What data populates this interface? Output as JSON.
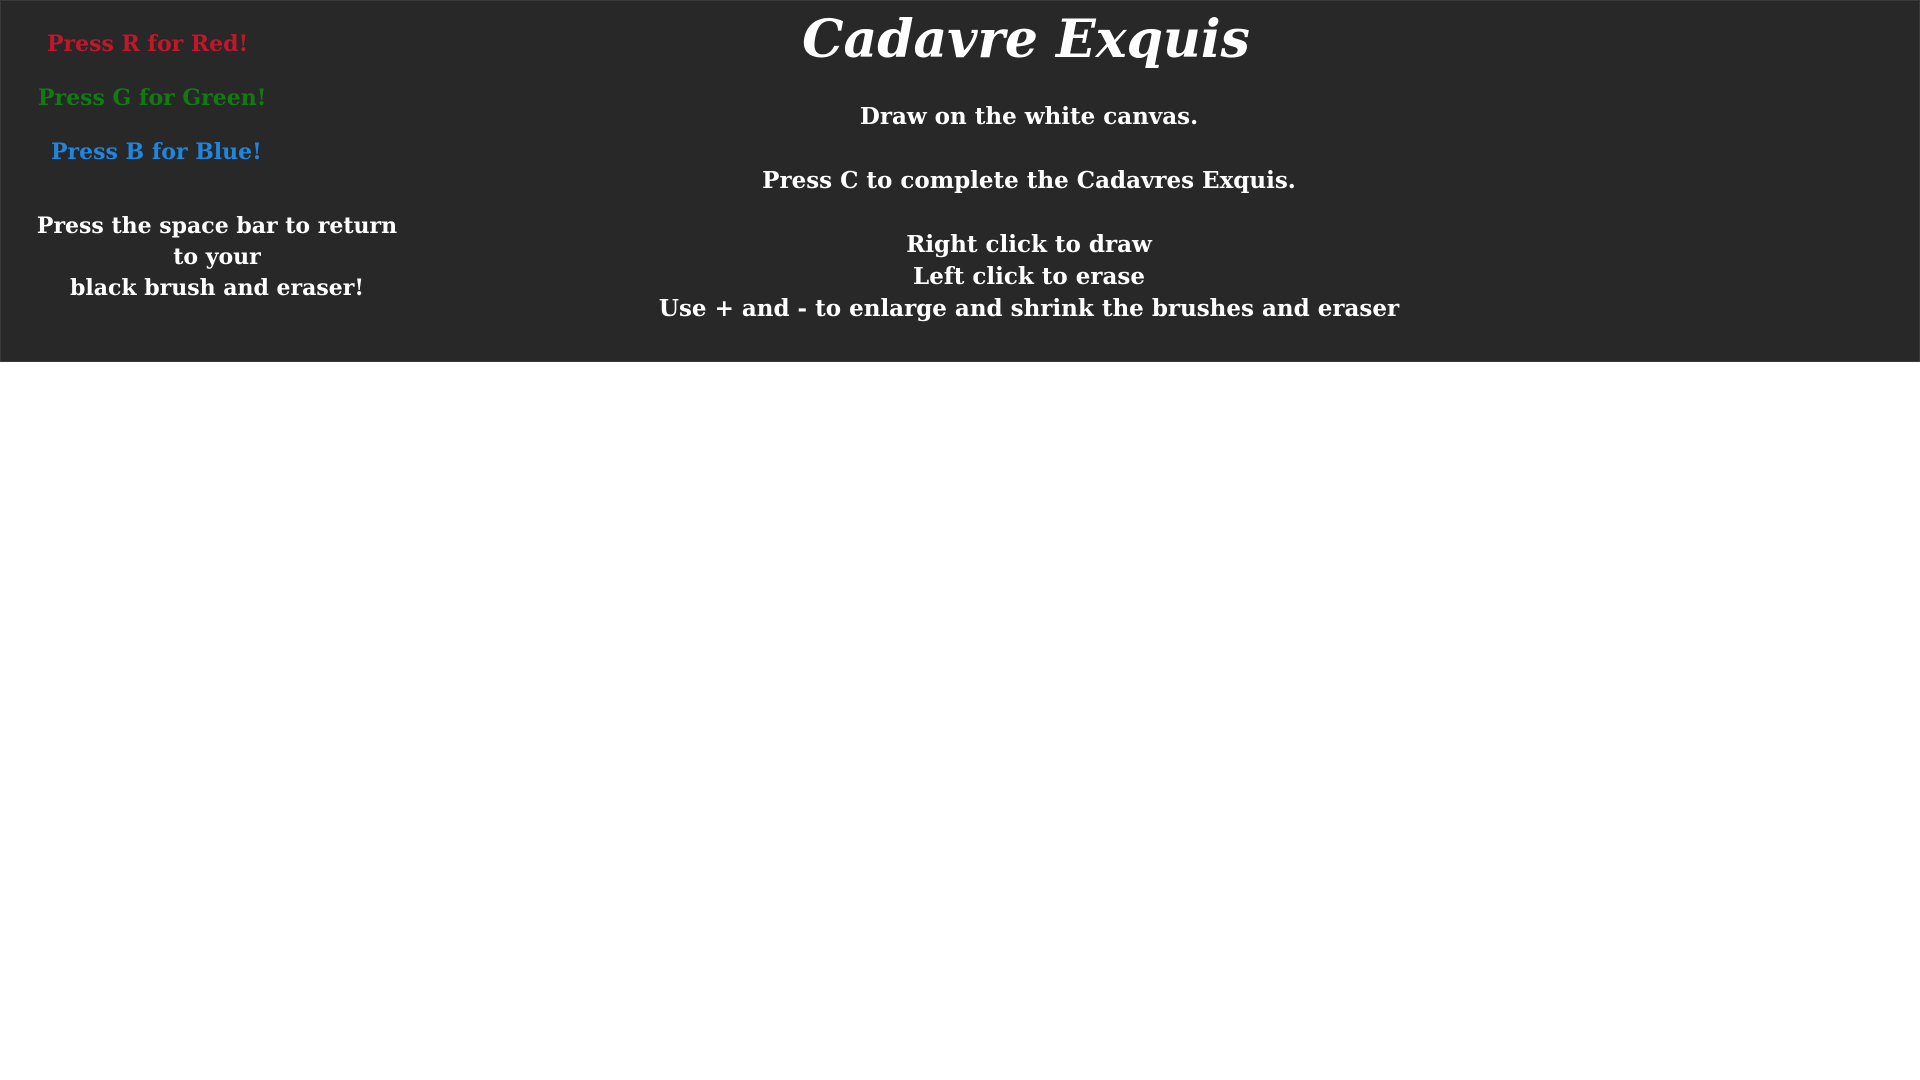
{
  "app": {
    "title": "Cadavre Exquis"
  },
  "instructions": {
    "line1": "Draw on the white canvas.",
    "line2": "Press C to complete the Cadavres Exquis.",
    "line3": "Right click to draw",
    "line4": "Left click to erase",
    "line5": "Use + and - to enlarge and shrink the brushes and eraser"
  },
  "color_hints": {
    "red": {
      "label": "Press R for Red!",
      "color": "#c0182a"
    },
    "green": {
      "label": "Press G for Green!",
      "color": "#127a12"
    },
    "blue": {
      "label": "Press B for Blue!",
      "color": "#1f86e0"
    },
    "space": "Press the space bar to return to your\nblack brush and eraser!"
  },
  "colors": {
    "header_bg": "#282828",
    "canvas_bg": "#ffffff",
    "brush_black": "#000000",
    "brush_red": "#c0182a",
    "brush_green": "#127a12"
  }
}
